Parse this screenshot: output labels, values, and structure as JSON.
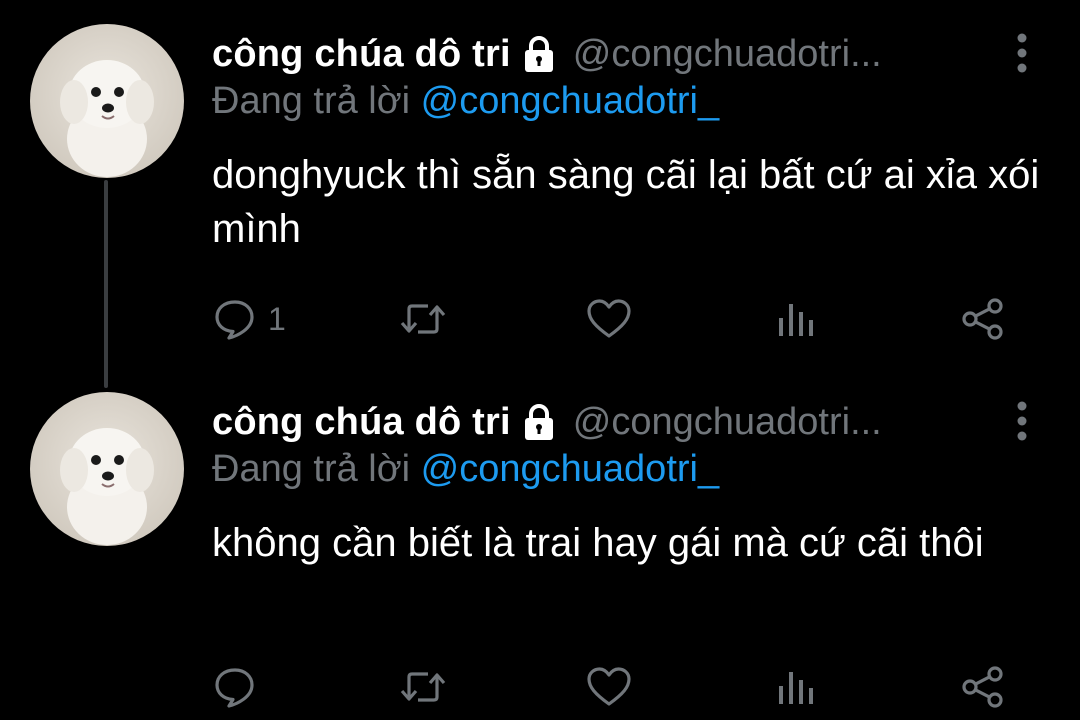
{
  "colors": {
    "background": "#000000",
    "text_primary": "#ffffff",
    "text_secondary": "#71767b",
    "link": "#1d9bf0"
  },
  "tweets": [
    {
      "display_name": "công chúa dô tri",
      "handle": "@congchuadotri...",
      "replying_to_label": "Đang trả lời",
      "replying_to_handle": "@congchuadotri_",
      "text": "donghyuck thì sẵn sàng cãi lại bất cứ ai xỉa xói mình",
      "reply_count": "1",
      "icons": [
        "lock-icon",
        "more-icon",
        "reply-icon",
        "retweet-icon",
        "like-icon",
        "views-icon",
        "share-icon"
      ]
    },
    {
      "display_name": "công chúa dô tri",
      "handle": "@congchuadotri...",
      "replying_to_label": "Đang trả lời",
      "replying_to_handle": "@congchuadotri_",
      "text": "không cần biết là trai hay gái mà cứ cãi thôi",
      "reply_count": "",
      "icons": [
        "lock-icon",
        "more-icon",
        "reply-icon",
        "retweet-icon",
        "like-icon",
        "views-icon",
        "share-icon"
      ]
    }
  ]
}
